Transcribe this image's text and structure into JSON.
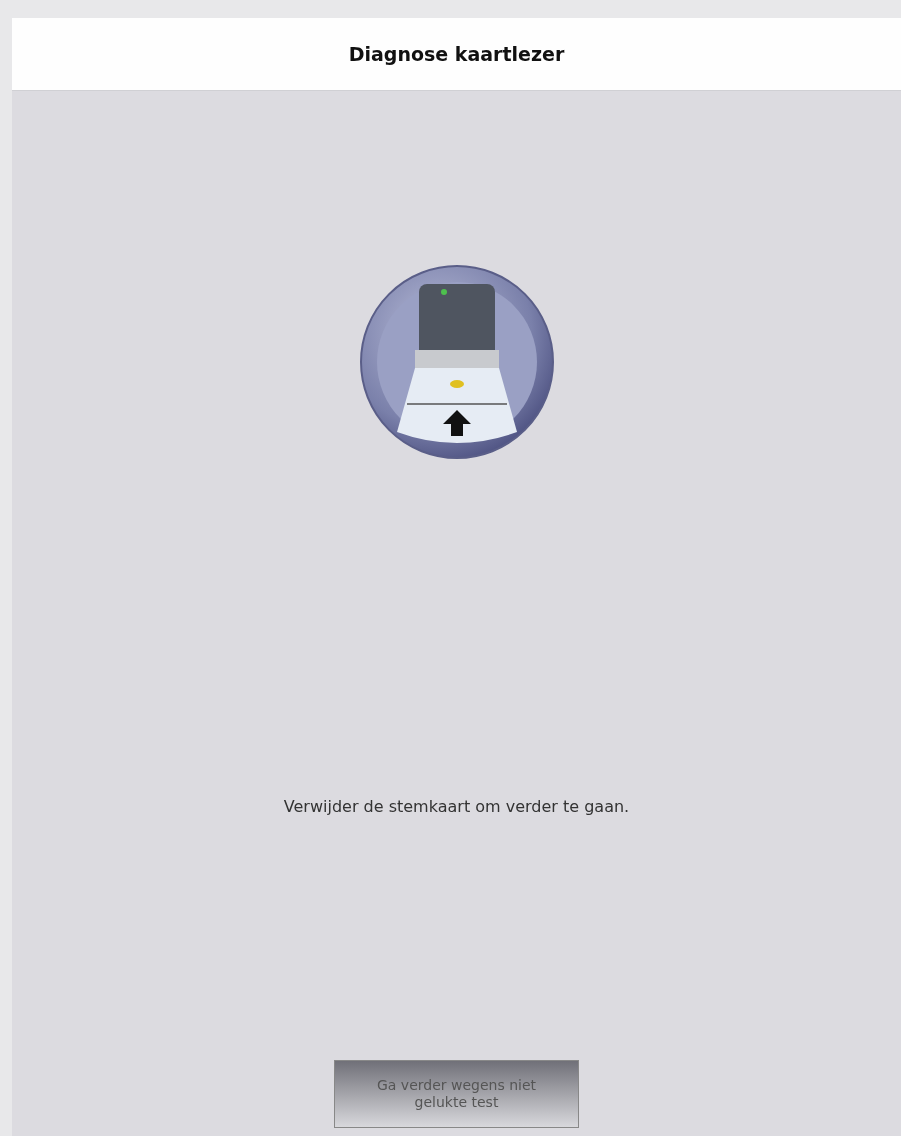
{
  "header": {
    "title": "Diagnose kaartlezer"
  },
  "message": "Verwijder de stemkaart om verder te gaan.",
  "button": {
    "label": "Ga verder wegens niet gelukte test",
    "disabled": true
  }
}
